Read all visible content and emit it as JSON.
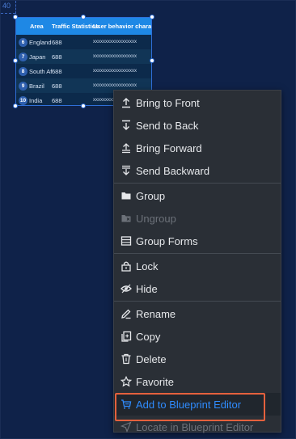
{
  "canvas": {
    "coord_label": "40"
  },
  "table_widget": {
    "headers": [
      "Area",
      "Traffic Statistics",
      "User behavior characte"
    ],
    "rows": [
      {
        "rank": "6",
        "area": "England",
        "traffic": "688",
        "behavior": "xxxxxxxxxxxxxxxxxx"
      },
      {
        "rank": "7",
        "area": "Japan",
        "traffic": "688",
        "behavior": "xxxxxxxxxxxxxxxxxx"
      },
      {
        "rank": "8",
        "area": "South Af",
        "traffic": "688",
        "behavior": "xxxxxxxxxxxxxxxxxx"
      },
      {
        "rank": "9",
        "area": "Brazil",
        "traffic": "688",
        "behavior": "xxxxxxxxxxxxxxxxxx"
      },
      {
        "rank": "10",
        "area": "India",
        "traffic": "688",
        "behavior": "xxxxxxxxxxxxxxxxxx"
      }
    ]
  },
  "context_menu": {
    "groups": [
      [
        {
          "label": "Bring to Front",
          "icon": "bring-to-front-icon"
        },
        {
          "label": "Send to Back",
          "icon": "send-to-back-icon"
        },
        {
          "label": "Bring Forward",
          "icon": "bring-forward-icon"
        },
        {
          "label": "Send Backward",
          "icon": "send-backward-icon"
        }
      ],
      [
        {
          "label": "Group",
          "icon": "folder-icon"
        },
        {
          "label": "Ungroup",
          "icon": "ungroup-folder-icon",
          "disabled": true
        },
        {
          "label": "Group Forms",
          "icon": "group-forms-icon"
        }
      ],
      [
        {
          "label": "Lock",
          "icon": "lock-icon"
        },
        {
          "label": "Hide",
          "icon": "eye-hide-icon"
        }
      ],
      [
        {
          "label": "Rename",
          "icon": "pencil-icon"
        },
        {
          "label": "Copy",
          "icon": "copy-icon"
        },
        {
          "label": "Delete",
          "icon": "trash-icon"
        },
        {
          "label": "Favorite",
          "icon": "star-icon"
        },
        {
          "label": "Add to Blueprint Editor",
          "icon": "blueprint-cart-icon",
          "active": true
        },
        {
          "label": "Locate in Blueprint Editor",
          "icon": "locate-arrow-icon",
          "disabled": true
        }
      ]
    ]
  },
  "colors": {
    "background": "#0f2249",
    "menu_bg": "#2a2f36",
    "accent": "#2f8cff",
    "highlight_border": "#e5613d",
    "table_header": "#1e88e5"
  }
}
